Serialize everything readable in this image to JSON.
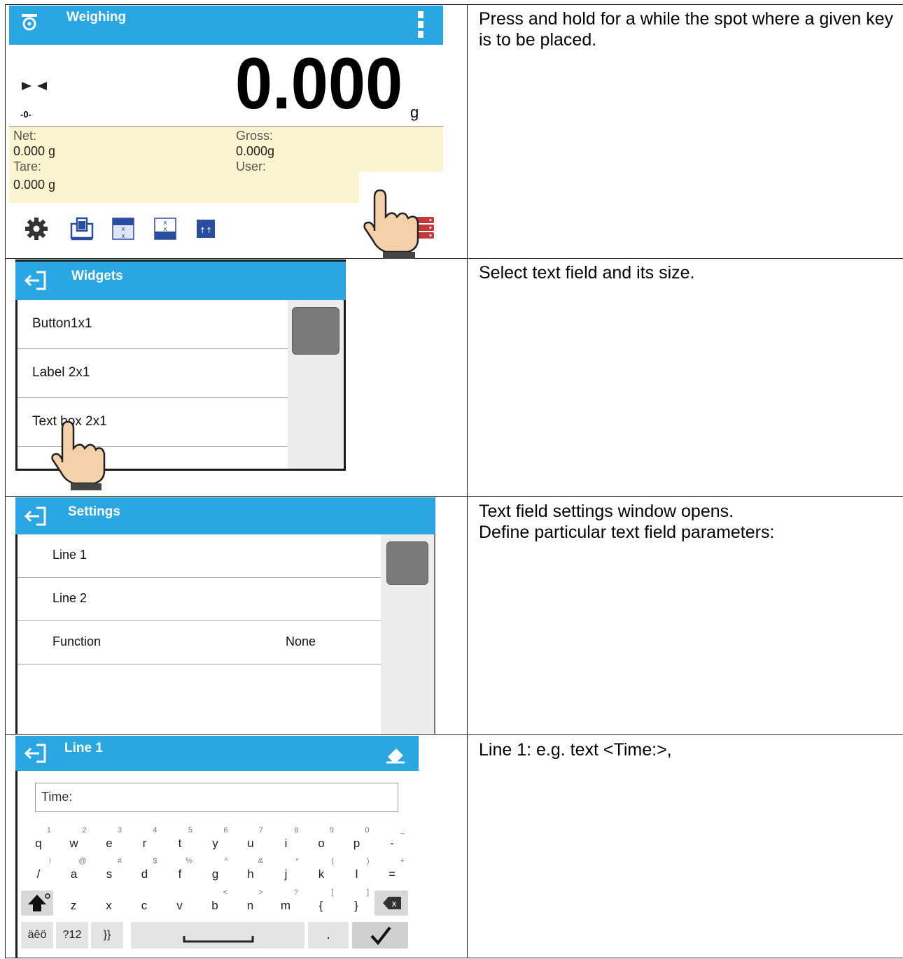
{
  "descriptions": {
    "row1": "Press and hold for a while the spot where a given key is to be placed.",
    "row2": "Select text field and its size.",
    "row3_line1": "Text field settings window opens.",
    "row3_line2": "Define particular text field parameters:",
    "row4": "Line 1: e.g. text <Time:>,"
  },
  "weighing": {
    "title": "Weighing",
    "value": "0.000",
    "unit": "g",
    "zero_indicator": "-0-",
    "net_label": "Net:",
    "net_value": "0.000 g",
    "gross_label": "Gross:",
    "gross_value": "0.000g",
    "tare_label": "Tare:",
    "tare_value": "0.000 g",
    "user_label": "User:",
    "user_value": ""
  },
  "widgets": {
    "title": "Widgets",
    "items": [
      "Button1x1",
      "Label 2x1",
      "Text box 2x1"
    ]
  },
  "settings": {
    "title": "Settings",
    "items": [
      {
        "label": "Line 1",
        "value": ""
      },
      {
        "label": "Line 2",
        "value": ""
      },
      {
        "label": "Function",
        "value": "None"
      }
    ]
  },
  "line1": {
    "title": "Line 1",
    "input_value": "Time:",
    "keyboard": {
      "row1": [
        [
          "q",
          "1"
        ],
        [
          "w",
          "2"
        ],
        [
          "e",
          "3"
        ],
        [
          "r",
          "4"
        ],
        [
          "t",
          "5"
        ],
        [
          "y",
          "6"
        ],
        [
          "u",
          "7"
        ],
        [
          "i",
          "8"
        ],
        [
          "o",
          "9"
        ],
        [
          "p",
          "0"
        ],
        [
          "-",
          "_"
        ]
      ],
      "row2": [
        [
          "/",
          "!"
        ],
        [
          "a",
          "@"
        ],
        [
          "s",
          "#"
        ],
        [
          "d",
          "$"
        ],
        [
          "f",
          "%"
        ],
        [
          "g",
          "^"
        ],
        [
          "h",
          "&"
        ],
        [
          "j",
          "*"
        ],
        [
          "k",
          "("
        ],
        [
          "l",
          ")"
        ],
        [
          "=",
          "+"
        ]
      ],
      "row3": [
        [
          "z",
          ""
        ],
        [
          "x",
          ""
        ],
        [
          "c",
          ""
        ],
        [
          "v",
          ""
        ],
        [
          "b",
          "<"
        ],
        [
          "n",
          ">"
        ],
        [
          "m",
          "?"
        ],
        [
          "{",
          "["
        ],
        [
          "}",
          "]"
        ]
      ],
      "row4_left": [
        "äêö",
        "?12",
        "}}"
      ],
      "period": "."
    }
  },
  "colors": {
    "header": "#2aa6e3",
    "info_band": "#fbf4cf",
    "scroll_thumb": "#7a7a7a"
  }
}
